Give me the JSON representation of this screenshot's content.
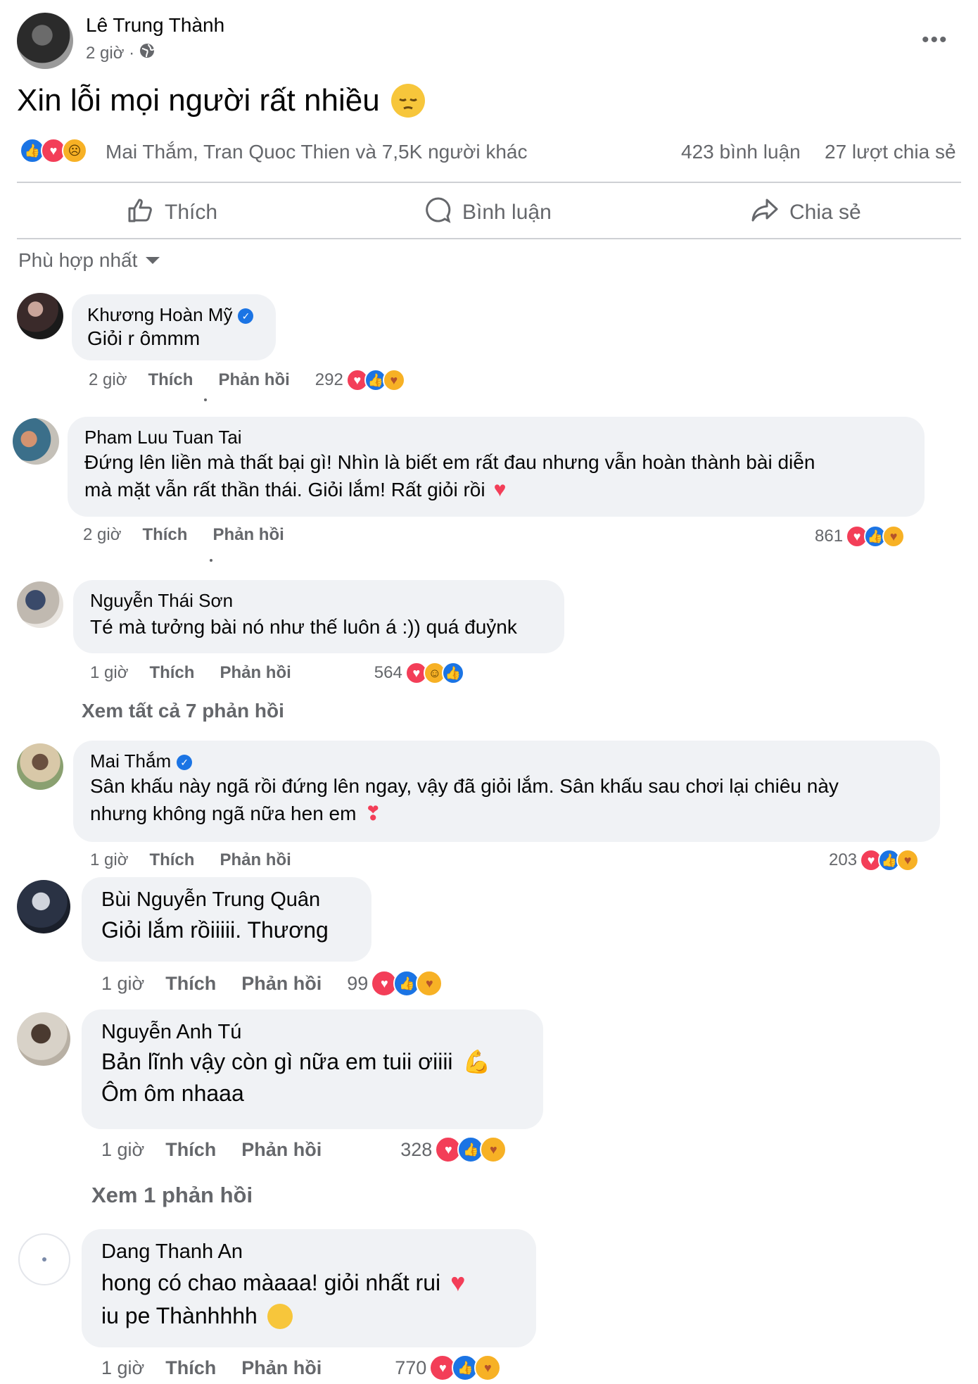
{
  "post": {
    "author": "Lê Trung Thành",
    "time": "2 giờ ·",
    "text": "Xin lỗi mọi người rất nhiều",
    "reactions_summary": "Mai Thắm, Tran Quoc Thien và 7,5K người khác",
    "comments_count": "423 bình luận",
    "shares_count": "27 lượt chia sẻ",
    "actions": {
      "like": "Thích",
      "comment": "Bình luận",
      "share": "Chia sẻ"
    },
    "sort_label": "Phù hợp nhất"
  },
  "comments": [
    {
      "name": "Khương Hoàn Mỹ",
      "verified": true,
      "text": "Giỏi r ômmm",
      "time": "2 giờ",
      "like": "Thích",
      "reply": "Phản hồi",
      "count": "292"
    },
    {
      "name": "Pham Luu Tuan Tai",
      "verified": false,
      "text_line1": "Đứng lên liền mà thất bại gì! Nhìn là biết em rất đau nhưng vẫn hoàn thành bài diễn",
      "text_line2": "mà mặt vẫn rất thần thái. Giỏi lắm! Rất giỏi rồi",
      "time": "2 giờ",
      "like": "Thích",
      "reply": "Phản hồi",
      "count": "861"
    },
    {
      "name": "Nguyễn Thái Sơn",
      "verified": false,
      "text": "Té mà tưởng bài nó như thế luôn á :)) quá đuỷnk",
      "time": "1 giờ",
      "like": "Thích",
      "reply": "Phản hồi",
      "count": "564",
      "view_replies": "Xem tất cả 7 phản hồi"
    },
    {
      "name": "Mai Thắm",
      "verified": true,
      "text_line1": "Sân khấu này ngã rồi đứng lên ngay, vậy đã giỏi lắm. Sân khấu sau chơi lại chiêu này",
      "text_line2": "nhưng không ngã nữa hen em",
      "time": "1 giờ",
      "like": "Thích",
      "reply": "Phản hồi",
      "count": "203"
    },
    {
      "name": "Bùi Nguyễn Trung Quân",
      "verified": false,
      "text": "Giỏi lắm rồiiiii. Thương",
      "time": "1 giờ",
      "like": "Thích",
      "reply": "Phản hồi",
      "count": "99"
    },
    {
      "name": "Nguyễn Anh Tú",
      "verified": false,
      "text_line1": "Bản lĩnh vậy còn gì nữa em tuii ơiiii",
      "text_line2": "Ôm ôm nhaaa",
      "time": "1 giờ",
      "like": "Thích",
      "reply": "Phản hồi",
      "count": "328",
      "view_replies": "Xem 1 phản hồi"
    },
    {
      "name": "Dang Thanh An",
      "verified": false,
      "text_line1": "hong có chao màaaa! giỏi nhất rui",
      "text_line2": "iu pe Thànhhhh",
      "time": "1 giờ",
      "like": "Thích",
      "reply": "Phản hồi",
      "count": "770"
    }
  ],
  "colors": {
    "bubble": "#f0f2f5",
    "meta": "#65676b",
    "like_blue": "#1b74e4",
    "heart_red": "#f33e58"
  }
}
